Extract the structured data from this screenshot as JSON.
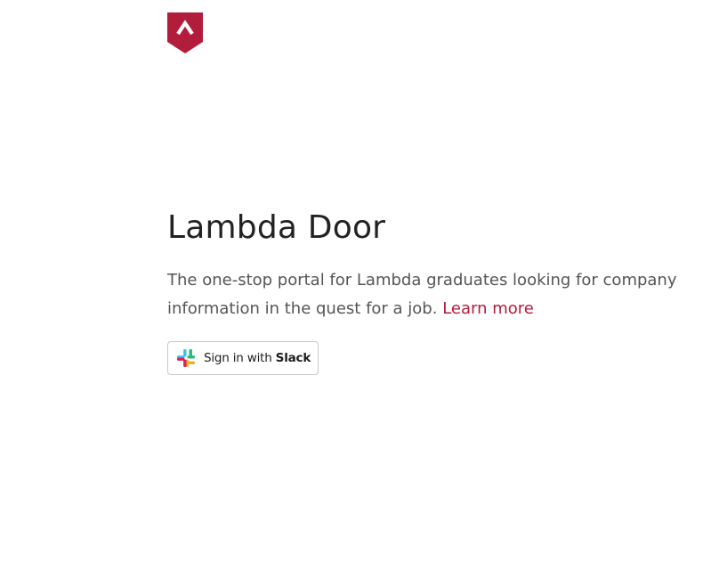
{
  "brand": {
    "logo_icon": "lambda-school-shield-icon",
    "logo_color": "#b21d3b"
  },
  "hero": {
    "title": "Lambda Door",
    "description": "The one-stop portal for Lambda graduates looking for company information in the quest for a job.",
    "learn_more_label": "Learn more",
    "link_color": "#b21d3b"
  },
  "auth": {
    "slack_button_prefix": "Sign in with ",
    "slack_button_brand": "Slack",
    "slack_icon": "slack-logo-icon"
  }
}
